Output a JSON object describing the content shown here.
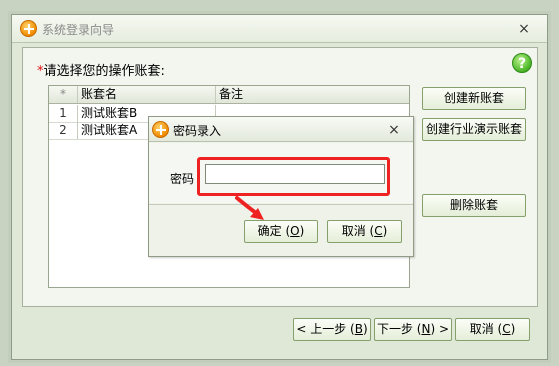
{
  "window": {
    "title": "系统登录向导",
    "close_symbol": "×",
    "prompt_star": "*",
    "prompt": "请选择您的操作账套:",
    "help_symbol": "?"
  },
  "grid": {
    "headers": {
      "marker": "*",
      "name": "账套名",
      "note": "备注"
    },
    "rows": [
      {
        "num": "1",
        "name": "测试账套B",
        "note": ""
      },
      {
        "num": "2",
        "name": "测试账套A",
        "note": ""
      }
    ]
  },
  "side_buttons": {
    "create": "创建新账套",
    "create_demo": "创建行业演示账套",
    "delete": "删除账套"
  },
  "nav_buttons": {
    "prev_prefix": "< 上一步 (",
    "prev_key": "B",
    "prev_suffix": ")",
    "next_prefix": "下一步 (",
    "next_key": "N",
    "next_suffix": ") >",
    "cancel_prefix": "取消 (",
    "cancel_key": "C",
    "cancel_suffix": ")"
  },
  "dialog": {
    "title": "密码录入",
    "close_symbol": "×",
    "password_label": "密码",
    "password_value": "",
    "ok_prefix": "确定 (",
    "ok_key": "O",
    "ok_suffix": ")",
    "cancel_prefix": "取消 (",
    "cancel_key": "C",
    "cancel_suffix": ")"
  },
  "colors": {
    "highlight": "#ef2222",
    "accent_green": "#86a06c"
  }
}
